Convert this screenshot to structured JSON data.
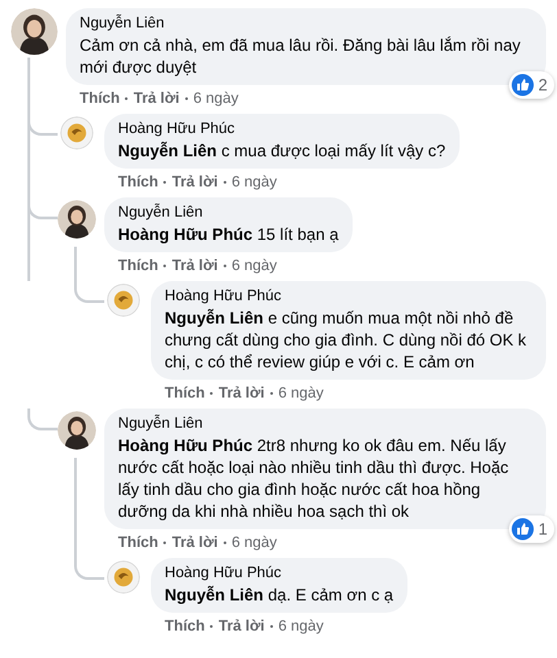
{
  "comments": [
    {
      "author": "Nguyễn Liên",
      "kind": "photo",
      "text": "Cảm ơn cả nhà, em đã mua lâu rồi. Đăng bài lâu lắm rồi nay mới được duyệt",
      "like": "Thích",
      "reply": "Trả lời",
      "time": "6 ngày",
      "reactions": "2",
      "children": [
        {
          "author": "Hoàng Hữu Phúc",
          "kind": "emblem",
          "text": "**Nguyễn Liên** c mua được loại mấy lít vậy c?",
          "like": "Thích",
          "reply": "Trả lời",
          "time": "6 ngày"
        },
        {
          "author": "Nguyễn Liên",
          "kind": "photo",
          "text": "**Hoàng Hữu Phúc** 15 lít bạn ạ",
          "like": "Thích",
          "reply": "Trả lời",
          "time": "6 ngày",
          "children": [
            {
              "author": "Hoàng Hữu Phúc",
              "kind": "emblem",
              "text": "**Nguyễn Liên** e cũng muốn mua một nồi nhỏ đề chưng cất dùng cho gia đình. C dùng nồi đó OK k chị, c có thể review giúp e với c. E cảm ơn",
              "like": "Thích",
              "reply": "Trả lời",
              "time": "6 ngày"
            }
          ]
        },
        {
          "author": "Nguyễn Liên",
          "kind": "photo",
          "text": "**Hoàng Hữu Phúc** 2tr8 nhưng ko ok đâu em. Nếu lấy nước cất hoặc loại nào nhiều tinh dầu thì được. Hoặc lấy tinh dầu cho gia đình hoặc nước cất hoa hồng dưỡng da khi nhà nhiều hoa sạch thì ok",
          "like": "Thích",
          "reply": "Trả lời",
          "time": "6 ngày",
          "reactions": "1",
          "children": [
            {
              "author": "Hoàng Hữu Phúc",
              "kind": "emblem",
              "text": "**Nguyễn Liên** dạ. E cảm ơn c ạ",
              "like": "Thích",
              "reply": "Trả lời",
              "time": "6 ngày"
            }
          ]
        }
      ]
    }
  ]
}
